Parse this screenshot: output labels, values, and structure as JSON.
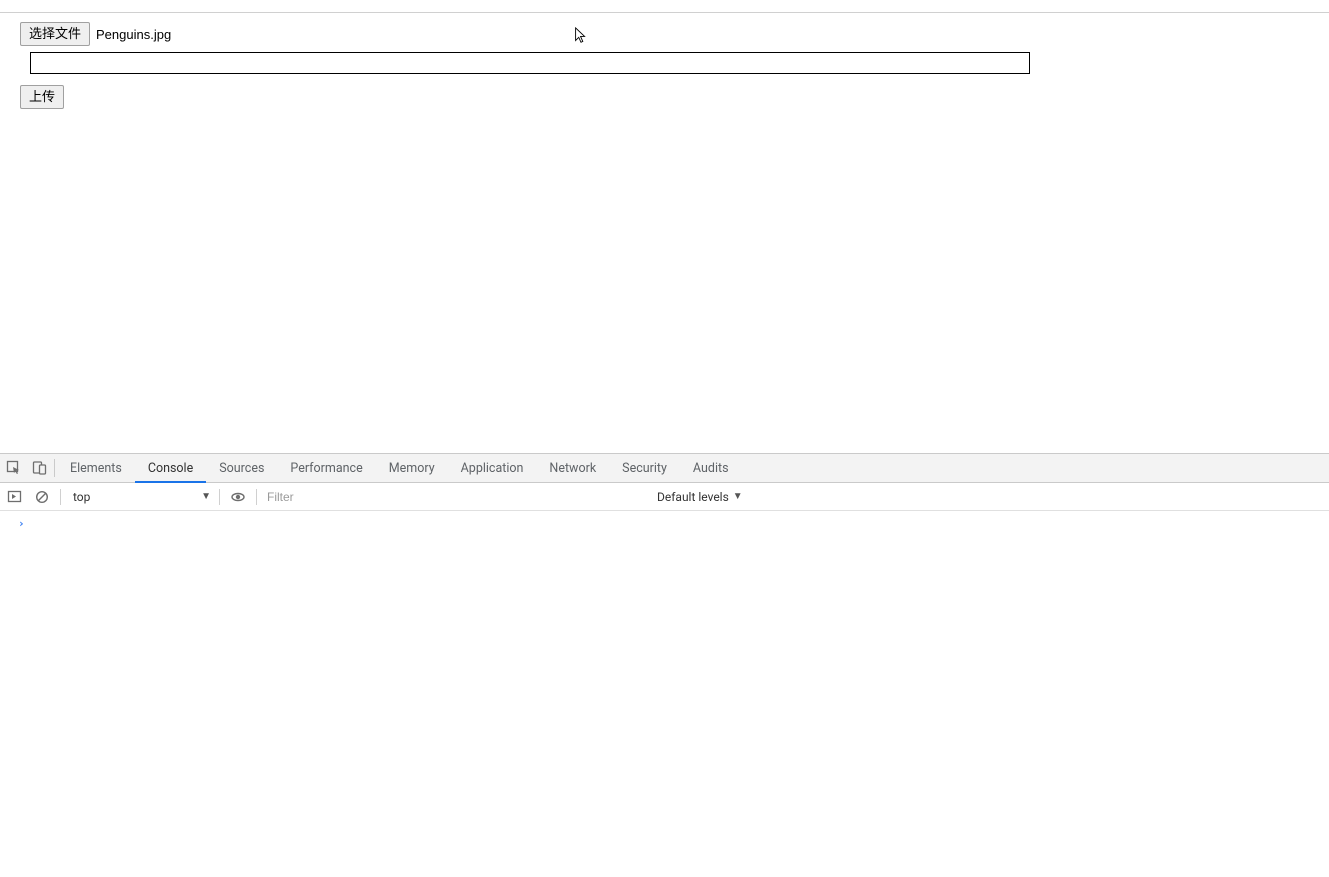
{
  "page": {
    "choose_file_label": "选择文件",
    "selected_filename": "Penguins.jpg",
    "upload_label": "上传"
  },
  "devtools": {
    "tabs": [
      "Elements",
      "Console",
      "Sources",
      "Performance",
      "Memory",
      "Application",
      "Network",
      "Security",
      "Audits"
    ],
    "active_tab_index": 1,
    "context_selector": "top",
    "filter_placeholder": "Filter",
    "levels_label": "Default levels",
    "prompt_symbol": "›"
  }
}
